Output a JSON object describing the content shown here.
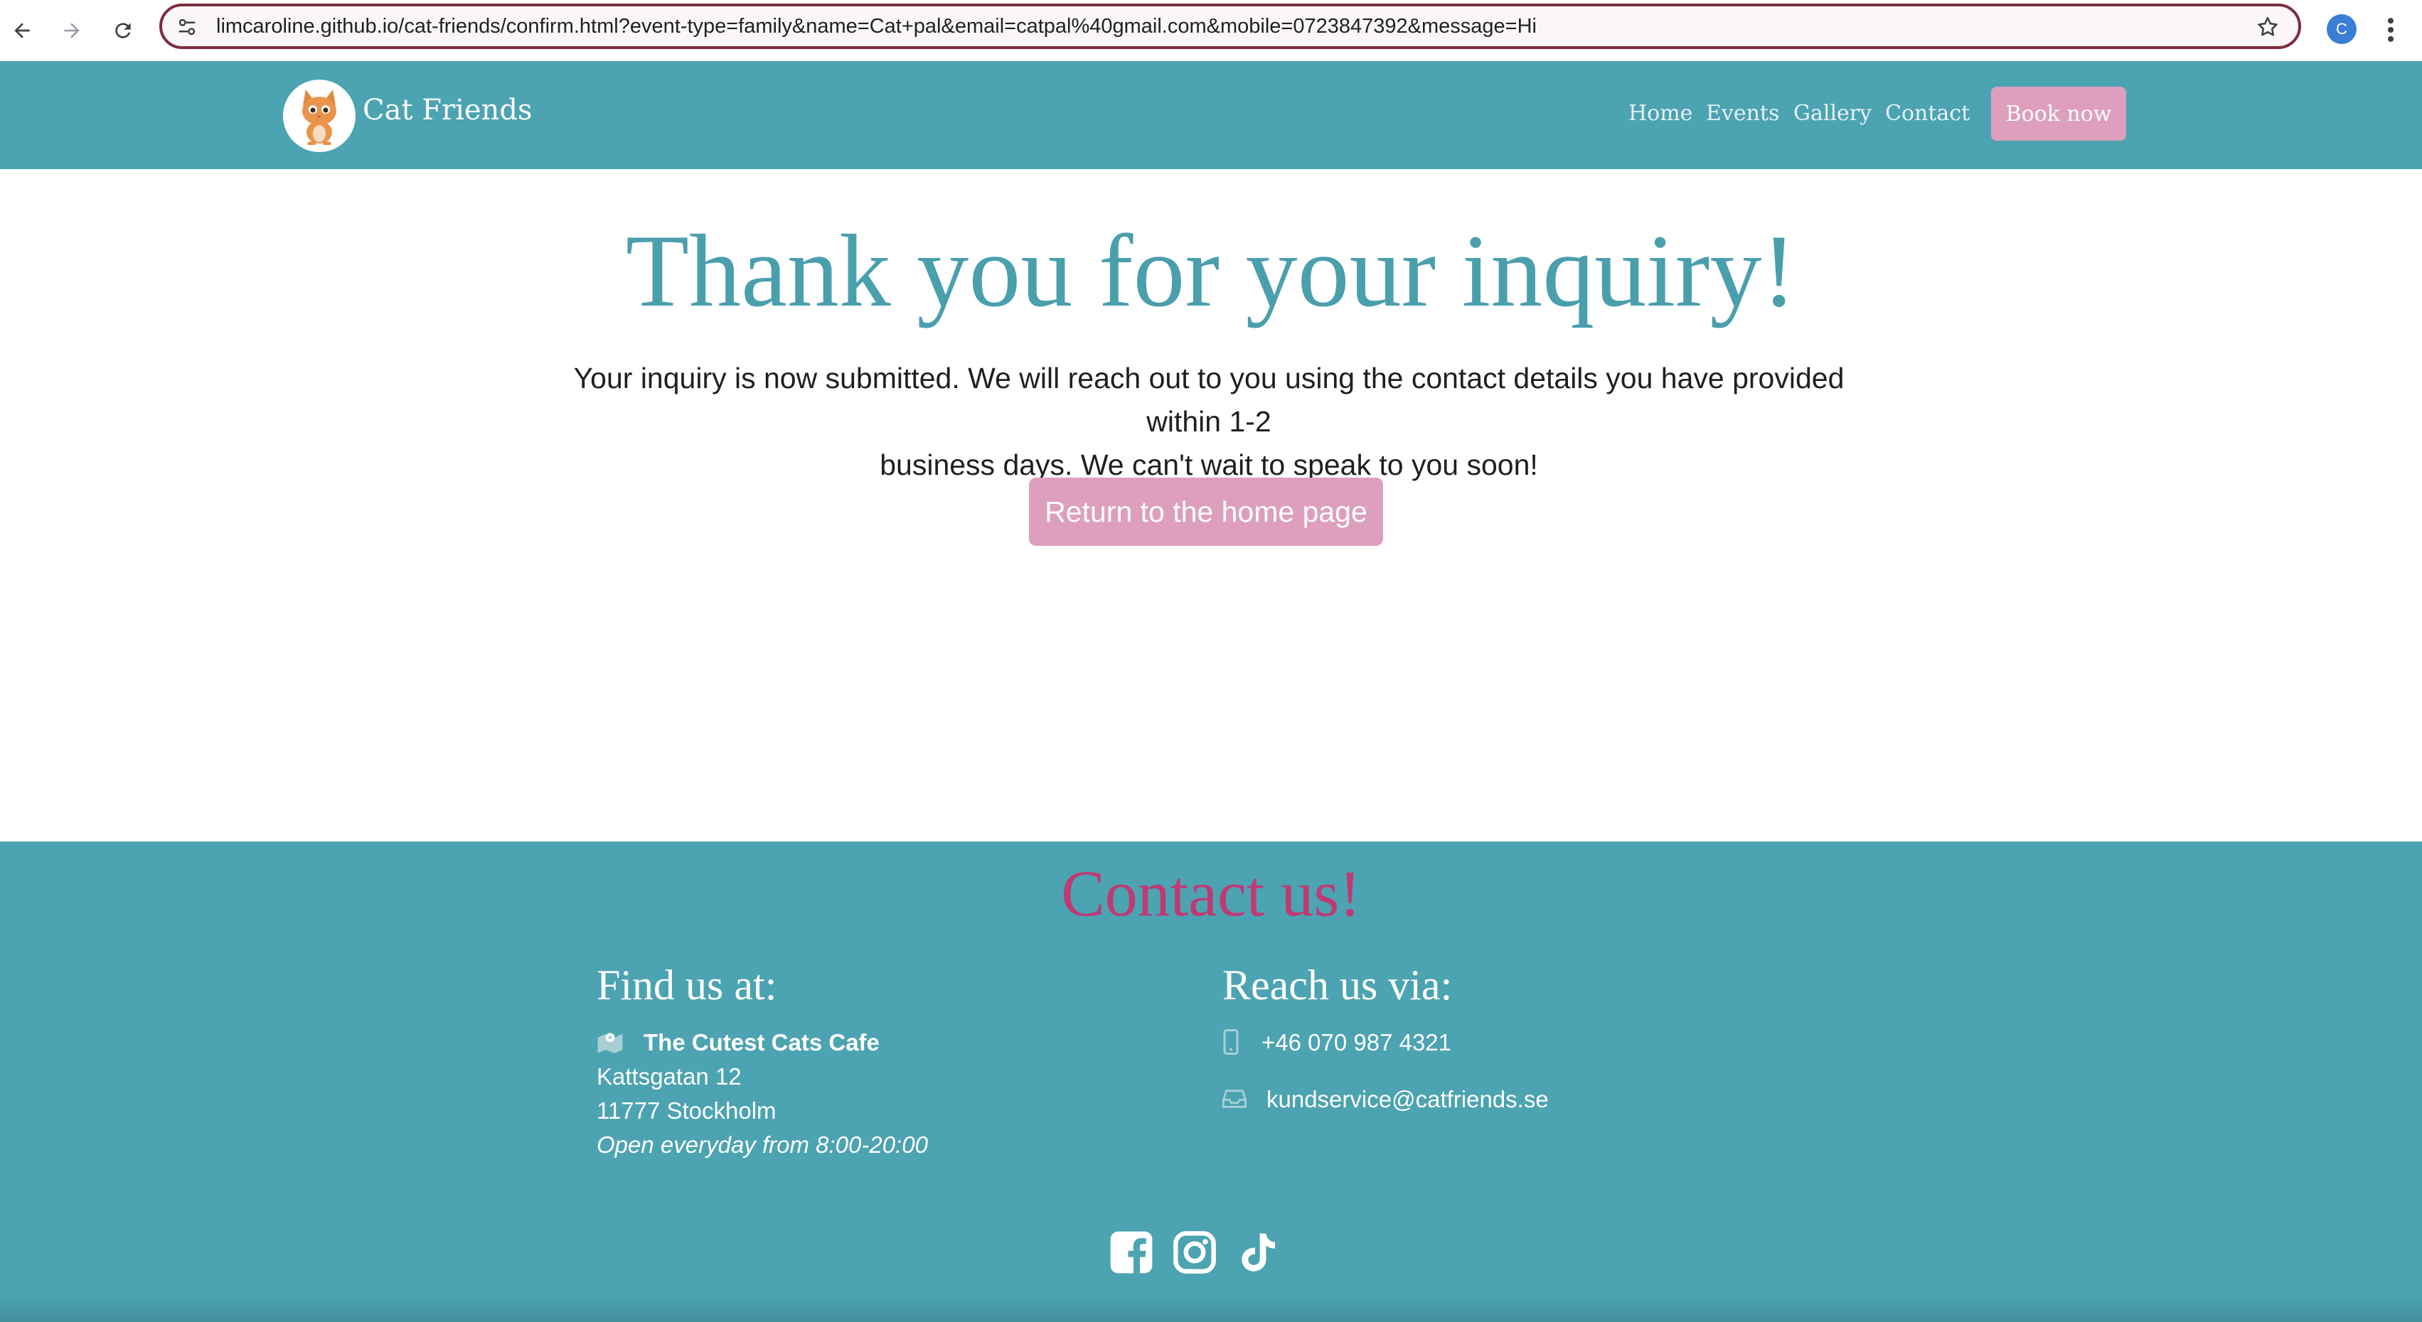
{
  "browser": {
    "url": "limcaroline.github.io/cat-friends/confirm.html?event-type=family&name=Cat+pal&email=catpal%40gmail.com&mobile=0723847392&message=Hi",
    "profile_initial": "C"
  },
  "header": {
    "brand": "Cat Friends",
    "nav": [
      "Home",
      "Events",
      "Gallery",
      "Contact"
    ],
    "book_label": "Book now"
  },
  "main": {
    "title": "Thank you for your inquiry!",
    "message_line1": "Your inquiry is now submitted. We will reach out to you using the contact details you have provided within 1-2",
    "message_line2": "business days. We can't wait to speak to you soon!",
    "home_button": "Return to the home page"
  },
  "footer": {
    "title": "Contact us!",
    "find": {
      "heading": "Find us at:",
      "name": "The Cutest Cats Cafe",
      "street": "Kattsgatan 12",
      "city": "11777 Stockholm",
      "hours": "Open everyday from 8:00-20:00"
    },
    "reach": {
      "heading": "Reach us via:",
      "phone": "+46 070 987 4321",
      "email": "kundservice@catfriends.se"
    },
    "social": [
      "facebook-icon",
      "instagram-icon",
      "tiktok-icon"
    ]
  },
  "colors": {
    "teal": "#4ca3b1",
    "pink": "#dd9fbd",
    "magenta": "#bf3a74",
    "title_teal": "#4a9fad"
  }
}
